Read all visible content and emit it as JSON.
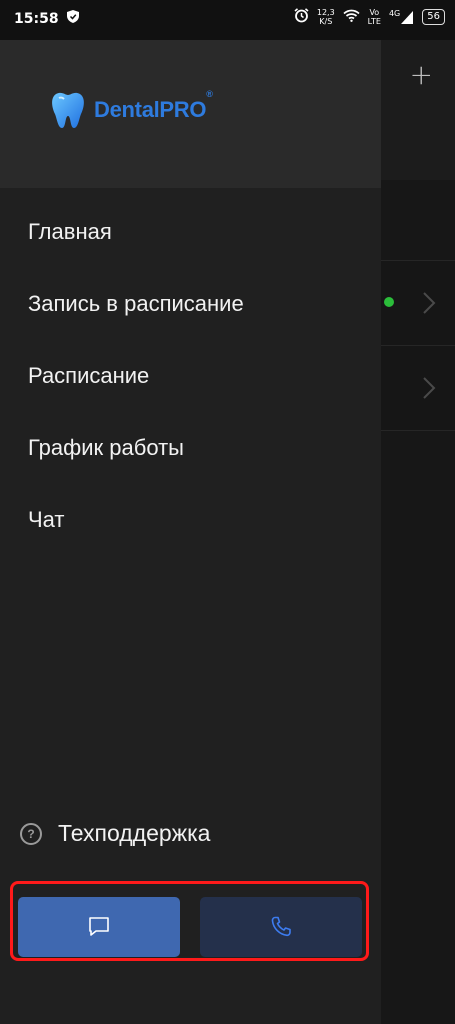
{
  "status_bar": {
    "time": "15:58",
    "speed_top": "12,3",
    "speed_bottom": "K/S",
    "volte_top": "Vo",
    "volte_bottom": "LTE",
    "network": "4G",
    "battery": "56"
  },
  "background": {
    "add_icon": "plus-icon",
    "online_color": "#2bbd3a"
  },
  "drawer": {
    "logo": {
      "text": "DentalPRO",
      "reg": "®",
      "color": "#2e7bde"
    },
    "menu": [
      {
        "label": "Главная"
      },
      {
        "label": "Запись в расписание"
      },
      {
        "label": "Расписание"
      },
      {
        "label": "График работы"
      },
      {
        "label": "Чат"
      }
    ],
    "support_label": "Техподдержка",
    "chat_button_icon": "message-icon",
    "call_button_icon": "phone-icon",
    "highlight_color": "#ff1a1a"
  }
}
